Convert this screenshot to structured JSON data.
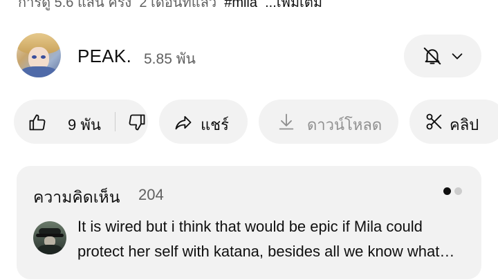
{
  "description_meta": {
    "views": "การดู 5.6 แสน ครั้ง",
    "age": "2 เดือนที่แล้ว",
    "hashtag": "#mila",
    "more": "...เพิ่มเติม"
  },
  "channel": {
    "name": "PEAK.",
    "subscribers": "5.85 พัน",
    "avatar_icon": "channel-avatar-icon"
  },
  "notification": {
    "icon": "bell-off-icon",
    "chevron": "chevron-down-icon"
  },
  "actions": {
    "like_count": "9 พัน",
    "share_label": "แชร์",
    "download_label": "ดาวน์โหลด",
    "clip_label": "คลิป"
  },
  "comments": {
    "title": "ความคิดเห็น",
    "count": "204",
    "top_comment_text": "It is wired but i think that would be epic if Mila could protect her self with katana, besides all we know what she has been through",
    "pager_total": 2,
    "pager_active": 1
  },
  "colors": {
    "pill_bg": "#f2f2f2",
    "text_primary": "#0f0f0f",
    "text_secondary": "#606060",
    "disabled": "#909090"
  }
}
